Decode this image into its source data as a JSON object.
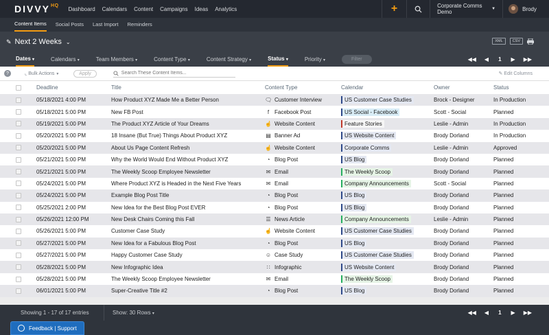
{
  "app": {
    "logo": "DIVVY",
    "logo_sup": "HQ",
    "nav": [
      "Dashboard",
      "Calendars",
      "Content",
      "Campaigns",
      "Ideas",
      "Analytics"
    ],
    "org": "Corporate Comms Demo",
    "user": "Brody"
  },
  "subnav": [
    "Content Items",
    "Social Posts",
    "Last Import",
    "Reminders"
  ],
  "page": {
    "title": "Next 2 Weeks",
    "xml": "XML",
    "csv": "CSV"
  },
  "filters": {
    "items": [
      "Dates",
      "Calendars",
      "Team Members",
      "Content Type",
      "Content Strategy",
      "Status",
      "Priority"
    ],
    "filter_btn": "Filter",
    "page": "1"
  },
  "toolbar": {
    "bulk": "Bulk Actions",
    "apply": "Apply",
    "search_placeholder": "Search These Content Items...",
    "edit_columns": "Edit Columns"
  },
  "table": {
    "headers": [
      "Deadline",
      "Title",
      "Content Type",
      "Calendar",
      "Owner",
      "Status"
    ],
    "rows": [
      {
        "deadline": "05/18/2021 4:00 PM",
        "title": "How Product XYZ Made Me a Better Person",
        "type": "Customer Interview",
        "type_icon": "chat-icon",
        "calendar": "US Customer Case Studies",
        "cal_color": "#2f4a8a",
        "cal_bg": "#e4e8f2",
        "owner": "Brock - Designer",
        "status": "In Production"
      },
      {
        "deadline": "05/18/2021 5:00 PM",
        "title": "New FB Post",
        "type": "Facebook Post",
        "type_icon": "facebook-icon",
        "calendar": "US Social - Facebook",
        "cal_color": "#2f4a8a",
        "cal_bg": "#d9edf7",
        "owner": "Scott - Social",
        "status": "Planned"
      },
      {
        "deadline": "05/19/2021 5:00 PM",
        "title": "The Product XYZ Article of Your Dreams",
        "type": "Website Content",
        "type_icon": "pointer-icon",
        "calendar": "Feature Stories",
        "cal_color": "#c0392b",
        "cal_bg": "#f6f6f6",
        "owner": "Leslie - Admin",
        "status": "In Production"
      },
      {
        "deadline": "05/20/2021 5:00 PM",
        "title": "18 Insane (But True) Things About Product XYZ",
        "type": "Banner Ad",
        "type_icon": "banner-icon",
        "calendar": "US Website Content",
        "cal_color": "#2f4a8a",
        "cal_bg": "#e4e8f2",
        "owner": "Brody Dorland",
        "status": "In Production"
      },
      {
        "deadline": "05/20/2021 5:00 PM",
        "title": "About Us Page Content Refresh",
        "type": "Website Content",
        "type_icon": "pointer-icon",
        "calendar": "Corporate Comms",
        "cal_color": "#2f4a8a",
        "cal_bg": "#e4e8f2",
        "owner": "Leslie - Admin",
        "status": "Approved"
      },
      {
        "deadline": "05/21/2021 5:00 PM",
        "title": "Why the World Would End Without Product XYZ",
        "type": "Blog Post",
        "type_icon": "rss-icon",
        "calendar": "US Blog",
        "cal_color": "#2f4a8a",
        "cal_bg": "#e4e8f2",
        "owner": "Brody Dorland",
        "status": "Planned"
      },
      {
        "deadline": "05/21/2021 5:00 PM",
        "title": "The Weekly Scoop Employee Newsletter",
        "type": "Email",
        "type_icon": "email-icon",
        "calendar": "The Weekly Scoop",
        "cal_color": "#27ae60",
        "cal_bg": "#e6f4e6",
        "owner": "Brody Dorland",
        "status": "Planned"
      },
      {
        "deadline": "05/24/2021 5:00 PM",
        "title": "Where Product XYZ is Headed in the Next Five Years",
        "type": "Email",
        "type_icon": "email-icon",
        "calendar": "Company Announcements",
        "cal_color": "#27ae60",
        "cal_bg": "#e6f4e6",
        "owner": "Scott - Social",
        "status": "Planned"
      },
      {
        "deadline": "05/24/2021 5:00 PM",
        "title": "Example Blog Post Title",
        "type": "Blog Post",
        "type_icon": "rss-icon",
        "calendar": "US Blog",
        "cal_color": "#2f4a8a",
        "cal_bg": "#e4e8f2",
        "owner": "Brody Dorland",
        "status": "Planned"
      },
      {
        "deadline": "05/25/2021 2:00 PM",
        "title": "New Idea for the Best Blog Post EVER",
        "type": "Blog Post",
        "type_icon": "rss-icon",
        "calendar": "US Blog",
        "cal_color": "#2f4a8a",
        "cal_bg": "#e4e8f2",
        "owner": "Brody Dorland",
        "status": "Planned"
      },
      {
        "deadline": "05/26/2021 12:00 PM",
        "title": "New Desk Chairs Coming this Fall",
        "type": "News Article",
        "type_icon": "document-icon",
        "calendar": "Company Announcements",
        "cal_color": "#27ae60",
        "cal_bg": "#e6f4e6",
        "owner": "Leslie - Admin",
        "status": "Planned"
      },
      {
        "deadline": "05/26/2021 5:00 PM",
        "title": "Customer Case Study",
        "type": "Website Content",
        "type_icon": "pointer-icon",
        "calendar": "US Customer Case Studies",
        "cal_color": "#2f4a8a",
        "cal_bg": "#e4e8f2",
        "owner": "Brody Dorland",
        "status": "Planned"
      },
      {
        "deadline": "05/27/2021 5:00 PM",
        "title": "New Idea for a Fabulous Blog Post",
        "type": "Blog Post",
        "type_icon": "rss-icon",
        "calendar": "US Blog",
        "cal_color": "#2f4a8a",
        "cal_bg": "#e4e8f2",
        "owner": "Brody Dorland",
        "status": "Planned"
      },
      {
        "deadline": "05/27/2021 5:00 PM",
        "title": "Happy Customer Case Study",
        "type": "Case Study",
        "type_icon": "person-icon",
        "calendar": "US Customer Case Studies",
        "cal_color": "#2f4a8a",
        "cal_bg": "#e4e8f2",
        "owner": "Brody Dorland",
        "status": "Planned"
      },
      {
        "deadline": "05/28/2021 5:00 PM",
        "title": "New Infographic Idea",
        "type": "Infographic",
        "type_icon": "chart-icon",
        "calendar": "US Website Content",
        "cal_color": "#2f4a8a",
        "cal_bg": "#e4e8f2",
        "owner": "Brody Dorland",
        "status": "Planned"
      },
      {
        "deadline": "05/28/2021 5:00 PM",
        "title": "The Weekly Scoop Employee Newsletter",
        "type": "Email",
        "type_icon": "email-icon",
        "calendar": "The Weekly Scoop",
        "cal_color": "#27ae60",
        "cal_bg": "#e6f4e6",
        "owner": "Brody Dorland",
        "status": "Planned"
      },
      {
        "deadline": "06/01/2021 5:00 PM",
        "title": "Super-Creative Title #2",
        "type": "Blog Post",
        "type_icon": "rss-icon",
        "calendar": "US Blog",
        "cal_color": "#2f4a8a",
        "cal_bg": "#e4e8f2",
        "owner": "Brody Dorland",
        "status": "Planned"
      }
    ]
  },
  "footer": {
    "showing": "Showing 1 - 17 of 17 entries",
    "show": "Show: 30 Rows",
    "page": "1"
  },
  "feedback": "Feedback | Support",
  "colors": {
    "accent": "#f39c12",
    "nav_bg": "#242830",
    "feedback": "#1f6dbe"
  }
}
